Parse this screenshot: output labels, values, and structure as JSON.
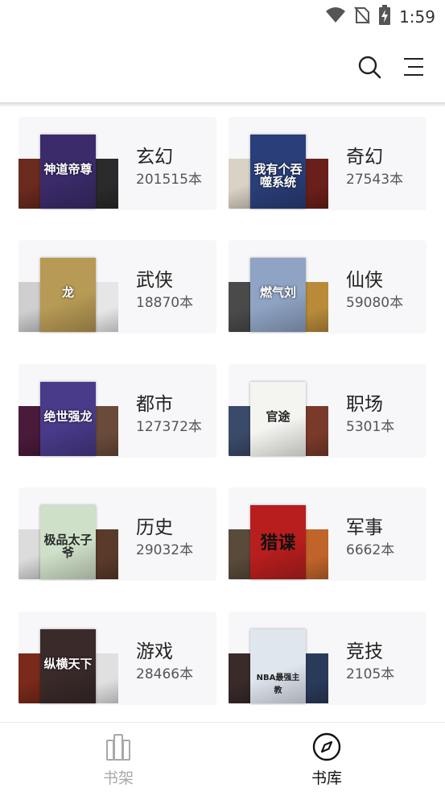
{
  "status_bar": {
    "time": "1:59",
    "icons": [
      "wifi-icon",
      "no-sim-icon",
      "battery-charging-icon"
    ]
  },
  "toolbar": {
    "search_icon": "search-icon",
    "menu_icon": "menu-lines-icon"
  },
  "categories": [
    {
      "name": "玄幻",
      "count": "201515本",
      "covers": [
        {
          "color": "#6a2a1e",
          "title": ""
        },
        {
          "color": "#3b2b6b",
          "title": "神道帝尊"
        },
        {
          "color": "#2a2a2a",
          "title": ""
        }
      ]
    },
    {
      "name": "奇幻",
      "count": "27543本",
      "covers": [
        {
          "color": "#d9d2c5",
          "title": ""
        },
        {
          "color": "#2a3f7a",
          "title": "我有个吞噬系统"
        },
        {
          "color": "#6a1f1a",
          "title": ""
        }
      ]
    },
    {
      "name": "武侠",
      "count": "18870本",
      "covers": [
        {
          "color": "#cfcfcf",
          "title": ""
        },
        {
          "color": "#b79a55",
          "title": "龙"
        },
        {
          "color": "#e6e6e6",
          "title": ""
        }
      ]
    },
    {
      "name": "仙侠",
      "count": "59080本",
      "covers": [
        {
          "color": "#4a4a4a",
          "title": ""
        },
        {
          "color": "#8fa4c4",
          "title": "燃气刘"
        },
        {
          "color": "#b88a3a",
          "title": ""
        }
      ]
    },
    {
      "name": "都市",
      "count": "127372本",
      "covers": [
        {
          "color": "#4a1a3a",
          "title": ""
        },
        {
          "color": "#4a3a8a",
          "title": "绝世强龙"
        },
        {
          "color": "#6a4a3a",
          "title": ""
        }
      ]
    },
    {
      "name": "职场",
      "count": "5301本",
      "covers": [
        {
          "color": "#3a4a6a",
          "title": ""
        },
        {
          "color": "#f4f4f0",
          "title": "官途"
        },
        {
          "color": "#7a3a2a",
          "title": ""
        }
      ]
    },
    {
      "name": "历史",
      "count": "29032本",
      "covers": [
        {
          "color": "#dcdcdc",
          "title": ""
        },
        {
          "color": "#cfe0c8",
          "title": "极品太子爷"
        },
        {
          "color": "#5a3a2a",
          "title": ""
        }
      ]
    },
    {
      "name": "军事",
      "count": "6662本",
      "covers": [
        {
          "color": "#5a4a3a",
          "title": ""
        },
        {
          "color": "#b81e1e",
          "title": "猎谍"
        },
        {
          "color": "#c0642a",
          "title": ""
        }
      ]
    },
    {
      "name": "游戏",
      "count": "28466本",
      "covers": [
        {
          "color": "#7a2a1a",
          "title": ""
        },
        {
          "color": "#3a2a2a",
          "title": "纵横天下"
        },
        {
          "color": "#e0e0e0",
          "title": ""
        }
      ]
    },
    {
      "name": "竞技",
      "count": "2105本",
      "covers": [
        {
          "color": "#3a2a2a",
          "title": ""
        },
        {
          "color": "#dfe6ee",
          "title": "NBA最强主教"
        },
        {
          "color": "#2a3a5a",
          "title": ""
        }
      ]
    }
  ],
  "bottom_nav": {
    "items": [
      {
        "label": "书架",
        "icon": "bookshelf-icon",
        "active": false
      },
      {
        "label": "书库",
        "icon": "compass-icon",
        "active": true
      }
    ]
  }
}
